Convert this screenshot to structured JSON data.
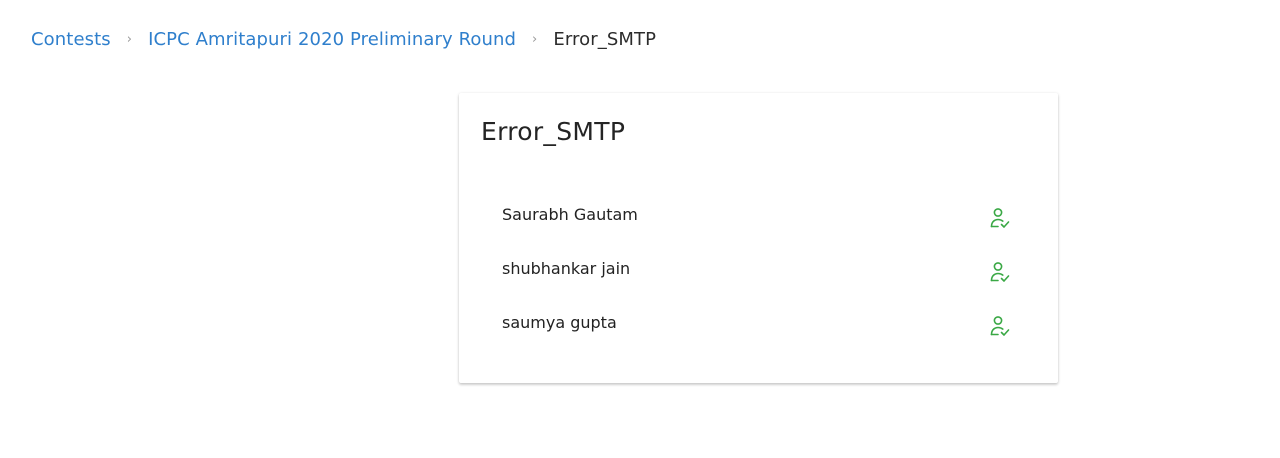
{
  "breadcrumb": {
    "items": [
      {
        "label": "Contests"
      },
      {
        "label": "ICPC Amritapuri 2020 Preliminary Round"
      }
    ],
    "current": "Error_SMTP",
    "separator_icon": "chevron-right-icon"
  },
  "team": {
    "title": "Error_SMTP",
    "members": [
      {
        "name": "Saurabh Gautam",
        "status_icon": "user-check-icon"
      },
      {
        "name": "shubhankar jain",
        "status_icon": "user-check-icon"
      },
      {
        "name": "saumya gupta",
        "status_icon": "user-check-icon"
      }
    ]
  },
  "colors": {
    "link": "#2f7fcc",
    "verified": "#3aa845",
    "text": "#222222"
  }
}
